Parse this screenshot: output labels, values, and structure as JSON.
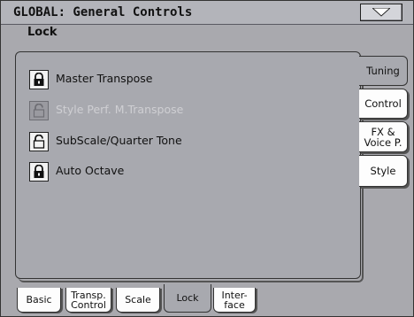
{
  "header": {
    "title": "GLOBAL: General Controls",
    "menu_icon": "triangle-down-icon"
  },
  "section": {
    "title": "Lock"
  },
  "lock_items": [
    {
      "label": "Master Transpose",
      "locked": true,
      "enabled": true
    },
    {
      "label": "Style Perf. M.Transpose",
      "locked": false,
      "enabled": false
    },
    {
      "label": "SubScale/Quarter Tone",
      "locked": false,
      "enabled": true
    },
    {
      "label": "Auto Octave",
      "locked": true,
      "enabled": true
    }
  ],
  "side_tabs": [
    {
      "label": "Tuning",
      "active": true
    },
    {
      "label": "Control",
      "active": false
    },
    {
      "label_line1": "FX &",
      "label_line2": "Voice P.",
      "active": false
    },
    {
      "label": "Style",
      "active": false
    }
  ],
  "bottom_tabs": [
    {
      "label": "Basic"
    },
    {
      "label_line1": "Transp.",
      "label_line2": "Control"
    },
    {
      "label": "Scale"
    },
    {
      "label": "Lock",
      "active": true
    },
    {
      "label_line1": "Inter-",
      "label_line2": "face"
    }
  ],
  "colors": {
    "background": "#a9a9ae",
    "tab_white": "#fdfdfd",
    "text": "#111111",
    "disabled_text": "#cfcfd3"
  }
}
